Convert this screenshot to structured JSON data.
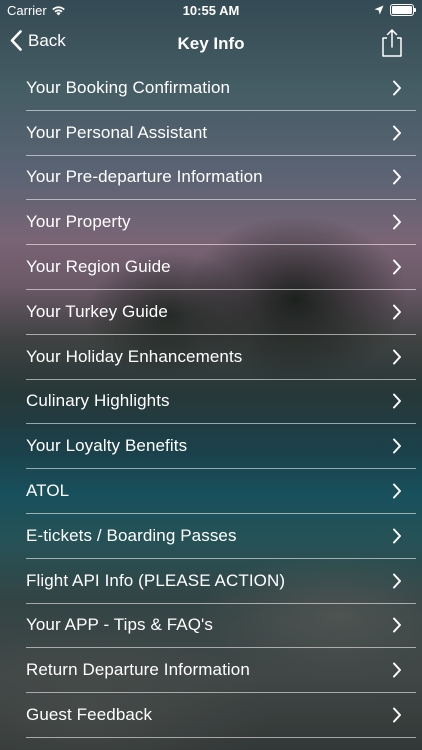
{
  "status_bar": {
    "carrier": "Carrier",
    "time": "10:55 AM",
    "icons": [
      "wifi-icon",
      "location-arrow-icon",
      "battery-icon"
    ]
  },
  "nav_bar": {
    "back_label": "Back",
    "title": "Key Info",
    "icons": [
      "back-chevron-icon",
      "share-icon"
    ]
  },
  "menu": {
    "items": [
      {
        "label": "Your Booking Confirmation"
      },
      {
        "label": "Your Personal Assistant"
      },
      {
        "label": "Your Pre-departure Information"
      },
      {
        "label": "Your Property"
      },
      {
        "label": "Your Region Guide"
      },
      {
        "label": "Your Turkey Guide"
      },
      {
        "label": "Your Holiday Enhancements"
      },
      {
        "label": "Culinary Highlights"
      },
      {
        "label": "Your Loyalty Benefits"
      },
      {
        "label": "ATOL"
      },
      {
        "label": "E-tickets / Boarding Passes"
      },
      {
        "label": "Flight API Info (PLEASE ACTION)"
      },
      {
        "label": "Your APP - Tips & FAQ's"
      },
      {
        "label": "Return Departure Information"
      },
      {
        "label": "Guest Feedback"
      }
    ]
  },
  "colors": {
    "text": "#ffffff",
    "separator": "#ffffff"
  }
}
